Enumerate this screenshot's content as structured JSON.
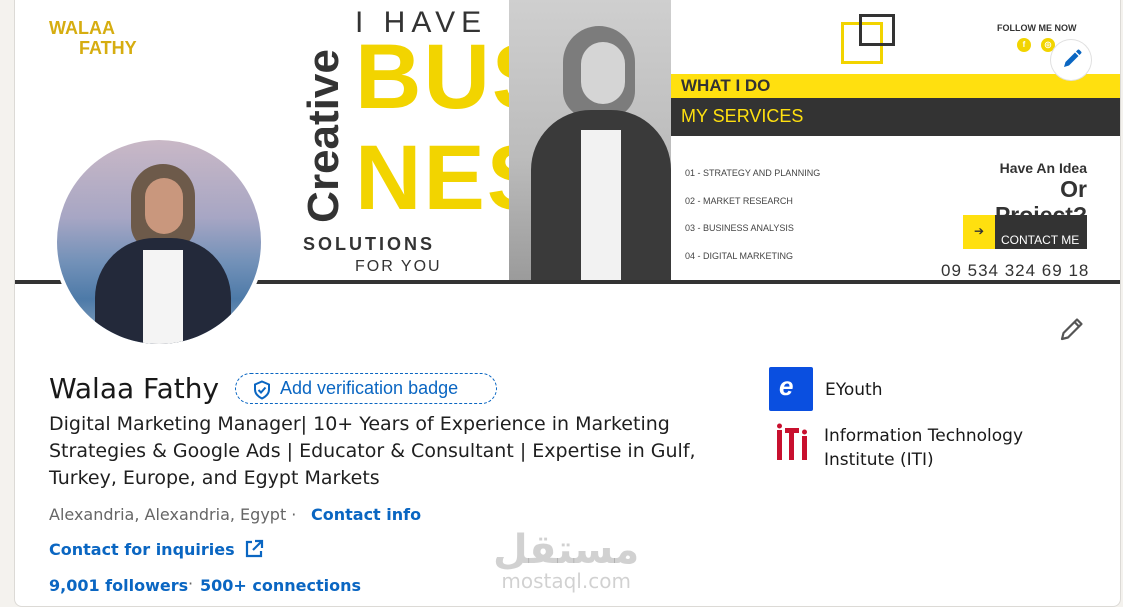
{
  "banner": {
    "logo_line1": "WALAA",
    "logo_line2": "FATHY",
    "creative": "Creative",
    "i_have": "I HAVE",
    "busi": "BUSI",
    "ness": "NESS",
    "solutions": "SOLUTIONS",
    "for_you": "FOR YOU",
    "what_i_do": "WHAT I DO",
    "my_services": "MY SERVICES",
    "services": [
      "01 - STRATEGY AND PLANNING",
      "02 - MARKET RESEARCH",
      "03 - BUSINESS ANALYSIS",
      "04 - DIGITAL MARKETING"
    ],
    "follow_me_now": "FOLLOW ME NOW",
    "idea_line1": "Have An Idea",
    "idea_line2": "Or Project?",
    "contact_arrow": "➔",
    "contact_me": "CONTACT ME",
    "phone": "09 534 324 69 18",
    "accent_color": "#ffe00f",
    "dark_color": "#333333"
  },
  "profile": {
    "name": "Walaa Fathy",
    "verification_badge": "Add verification badge",
    "headline": "Digital Marketing Manager| 10+ Years of Experience in Marketing Strategies & Google Ads | Educator & Consultant | Expertise in Gulf, Turkey, Europe, and Egypt Markets",
    "location": "Alexandria, Alexandria, Egypt ·",
    "contact_info": "Contact info",
    "inquiries": "Contact for inquiries",
    "followers": "9,001 followers",
    "dot": "·",
    "connections": "500+ connections",
    "link_color": "#0a66c2"
  },
  "organizations": [
    {
      "name": "EYouth",
      "logo_letter": "e"
    },
    {
      "name": "Information Technology Institute (ITI)",
      "logo_letter": "iti"
    }
  ],
  "watermark": {
    "arabic": "مستقل",
    "latin": "mostaql.com"
  }
}
